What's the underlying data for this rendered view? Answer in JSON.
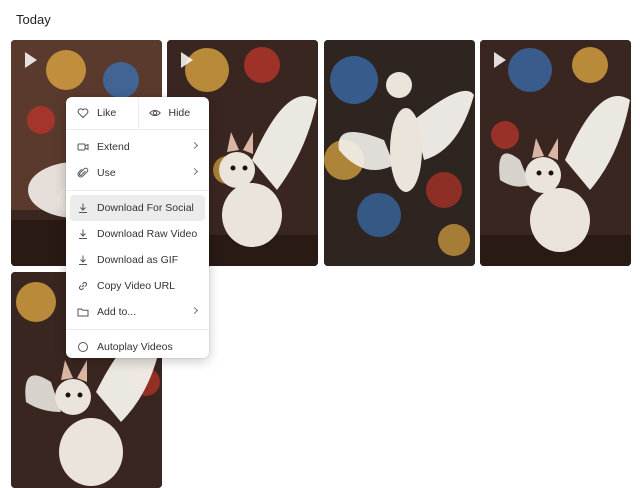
{
  "section": {
    "title": "Today"
  },
  "gallery": {
    "tiles": [
      {
        "name": "video-thumbnail-1",
        "has_play_icon": true
      },
      {
        "name": "video-thumbnail-2",
        "has_play_icon": true
      },
      {
        "name": "video-thumbnail-3",
        "has_play_icon": false
      },
      {
        "name": "video-thumbnail-4",
        "has_play_icon": true
      },
      {
        "name": "video-thumbnail-5",
        "has_play_icon": false
      }
    ]
  },
  "context_menu": {
    "like": {
      "label": "Like",
      "icon": "heart-icon"
    },
    "hide": {
      "label": "Hide",
      "icon": "eye-icon"
    },
    "extend": {
      "label": "Extend",
      "icon": "video-camera-icon"
    },
    "use": {
      "label": "Use",
      "icon": "paperclip-icon"
    },
    "download_social": {
      "label": "Download For Social",
      "icon": "download-icon"
    },
    "download_raw": {
      "label": "Download Raw Video",
      "icon": "download-icon"
    },
    "download_gif": {
      "label": "Download as GIF",
      "icon": "download-icon"
    },
    "copy_url": {
      "label": "Copy Video URL",
      "icon": "link-icon"
    },
    "add_to": {
      "label": "Add to...",
      "icon": "folder-icon"
    },
    "autoplay": {
      "label": "Autoplay Videos",
      "icon": "radio-circle-icon"
    }
  },
  "colors": {
    "menu_highlight": "#ececec",
    "glass_red": "#b8352a",
    "glass_blue": "#3b6fb0",
    "glass_gold": "#d9a441",
    "dog_fur": "#eae4da",
    "wing": "#f4f1ec"
  }
}
